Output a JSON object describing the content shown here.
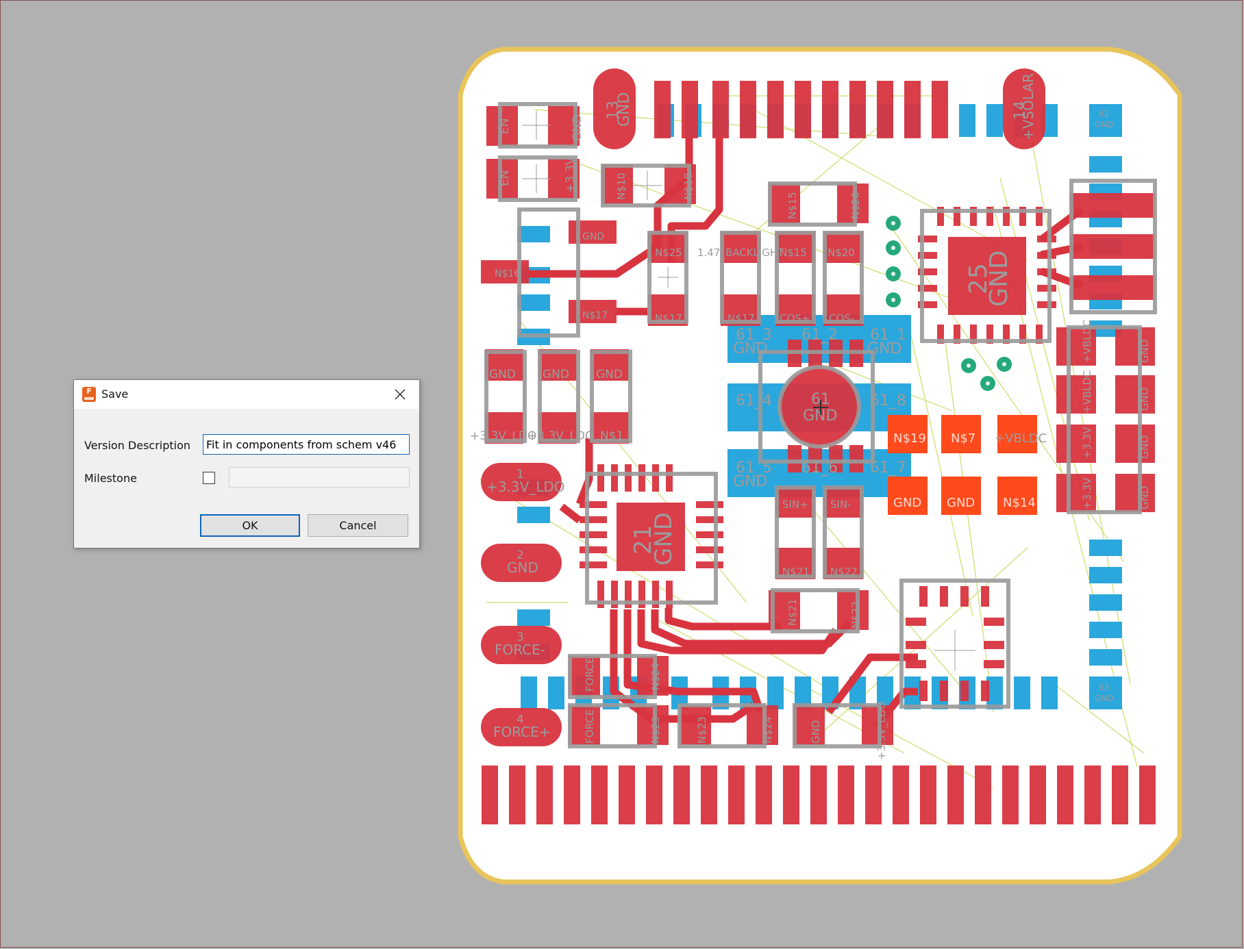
{
  "dialog": {
    "title": "Save",
    "app_icon_letter": "F",
    "version_description_label": "Version Description",
    "version_description_value": "Fit in components from schem v46",
    "milestone_label": "Milestone",
    "milestone_checked": false,
    "ok_label": "OK",
    "cancel_label": "Cancel"
  },
  "pcb": {
    "colors": {
      "background": "#b1b1b1",
      "board": "#ffffff",
      "outline": "#e8c45a",
      "top_copper": "#d7343f",
      "bottom_copper": "#2aa7dc",
      "highlight_pad": "#ff4a1c",
      "silkscreen": "#9a9a9a",
      "airwire": "#cddc6b",
      "via": "#26a87d"
    },
    "labels": {
      "big_gnd_13": "13",
      "gnd": "GND",
      "vsolar_14": "14",
      "vsolar": "+VSOLAR",
      "en": "EN",
      "v33": "+3.3V",
      "ns10": "N$10",
      "ns18": "N$18",
      "ns15": "N$15",
      "ns20": "N$20",
      "ns16": "N$16",
      "ns25": "N$25",
      "backlight": "1.47_BACKLIGHT",
      "ns17": "N$17",
      "cos_plus": "COS+",
      "cos_minus": "COS-",
      "n25": "25",
      "n21": "21",
      "n61": "61",
      "n61_1": "61_1",
      "n61_2": "61_2",
      "n61_3": "61_3",
      "n61_4": "61_4",
      "n61_5": "61_5",
      "n61_6": "61_6",
      "n61_7": "61_7",
      "n61_8": "61_8",
      "v33_ldo": "+3.3V_LDO",
      "ns1": "N$1",
      "ns19": "N$19",
      "ns7": "N$7",
      "vbldc": "+VBLDC",
      "ns14": "N$14",
      "sin_plus": "SIN+",
      "sin_minus": "SIN-",
      "ns21": "N$21",
      "ns22": "N$22",
      "force_minus": "FORCE-",
      "force_plus": "FORCE+",
      "force": "FORCE",
      "ns23": "N$23",
      "ns24": "N$24",
      "n1": "1",
      "n2": "2",
      "n3": "3",
      "n4": "4",
      "n62": "62",
      "n63": "63"
    }
  }
}
